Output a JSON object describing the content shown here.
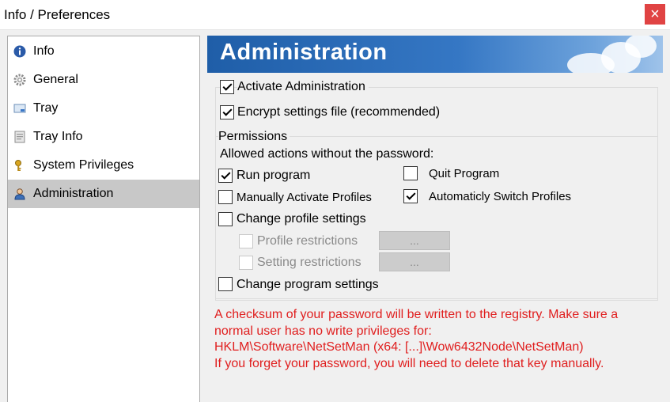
{
  "window": {
    "title": "Info / Preferences",
    "close_glyph": "×"
  },
  "sidebar": {
    "items": [
      {
        "label": "Info",
        "icon": "info-icon"
      },
      {
        "label": "General",
        "icon": "gear-icon"
      },
      {
        "label": "Tray",
        "icon": "tray-icon"
      },
      {
        "label": "Tray Info",
        "icon": "tray-info-icon"
      },
      {
        "label": "System Privileges",
        "icon": "key-icon"
      },
      {
        "label": "Administration",
        "icon": "user-icon",
        "active": true
      }
    ]
  },
  "banner": {
    "title": "Administration"
  },
  "options": {
    "activate_admin": {
      "label": "Activate Administration",
      "checked": true
    },
    "encrypt_settings": {
      "label": "Encrypt settings file (recommended)",
      "checked": true
    }
  },
  "permissions": {
    "group_label": "Permissions",
    "allowed_label": "Allowed actions without the password:",
    "run_program": {
      "label": "Run program",
      "checked": true
    },
    "quit_program": {
      "label": "Quit Program",
      "checked": false
    },
    "manually_activate": {
      "label": "Manually Activate Profiles",
      "checked": false
    },
    "auto_switch": {
      "label": "Automaticly Switch Profiles",
      "checked": true
    },
    "change_profile": {
      "label": "Change profile settings",
      "checked": false
    },
    "profile_restrictions": {
      "label": "Profile restrictions",
      "button": "...",
      "enabled": false
    },
    "setting_restrictions": {
      "label": "Setting restrictions",
      "button": "...",
      "enabled": false
    },
    "change_program": {
      "label": "Change program settings",
      "checked": false
    }
  },
  "warning": {
    "line1": "A checksum of your password will be written to the registry. Make sure a",
    "line2": "normal user has no write privileges for:",
    "line3": "HKLM\\Software\\NetSetMan (x64: [...]\\Wow6432Node\\NetSetMan)",
    "line4": "If you forget your password, you will need to delete that key manually."
  },
  "colors": {
    "warning_text": "#e01e1e",
    "banner_blue": "#2a6cb8",
    "active_item": "#c8c8c8",
    "close_button": "#e04343"
  }
}
